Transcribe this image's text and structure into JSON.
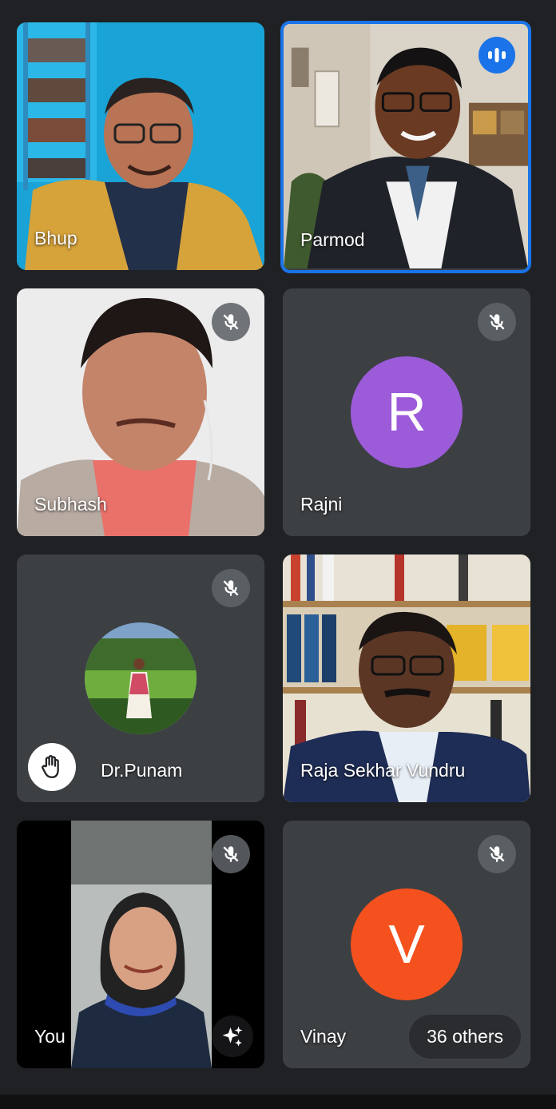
{
  "participants": [
    {
      "name": "Bhup",
      "muted": false
    },
    {
      "name": "Parmod",
      "muted": false,
      "speaking": true
    },
    {
      "name": "Subhash",
      "muted": true
    },
    {
      "name": "Rajni",
      "muted": true,
      "avatar_letter": "R",
      "avatar_color": "#9c5bd9"
    },
    {
      "name": "Dr.Punam",
      "muted": true,
      "hand_raised": true
    },
    {
      "name": "Raja Sekhar Vundru",
      "muted": false
    },
    {
      "name": "You",
      "muted": true
    },
    {
      "name": "Vinay",
      "muted": true,
      "avatar_letter": "V",
      "avatar_color": "#f4511e"
    }
  ],
  "others_label": "36 others",
  "colors": {
    "tile_bg": "#3c4043",
    "page_bg": "#202124",
    "speaking_border": "#1a73e8"
  },
  "icons": {
    "mute": "mic-off-icon",
    "speaking": "audio-level-icon",
    "hand": "raised-hand-icon",
    "effects": "sparkle-icon"
  }
}
